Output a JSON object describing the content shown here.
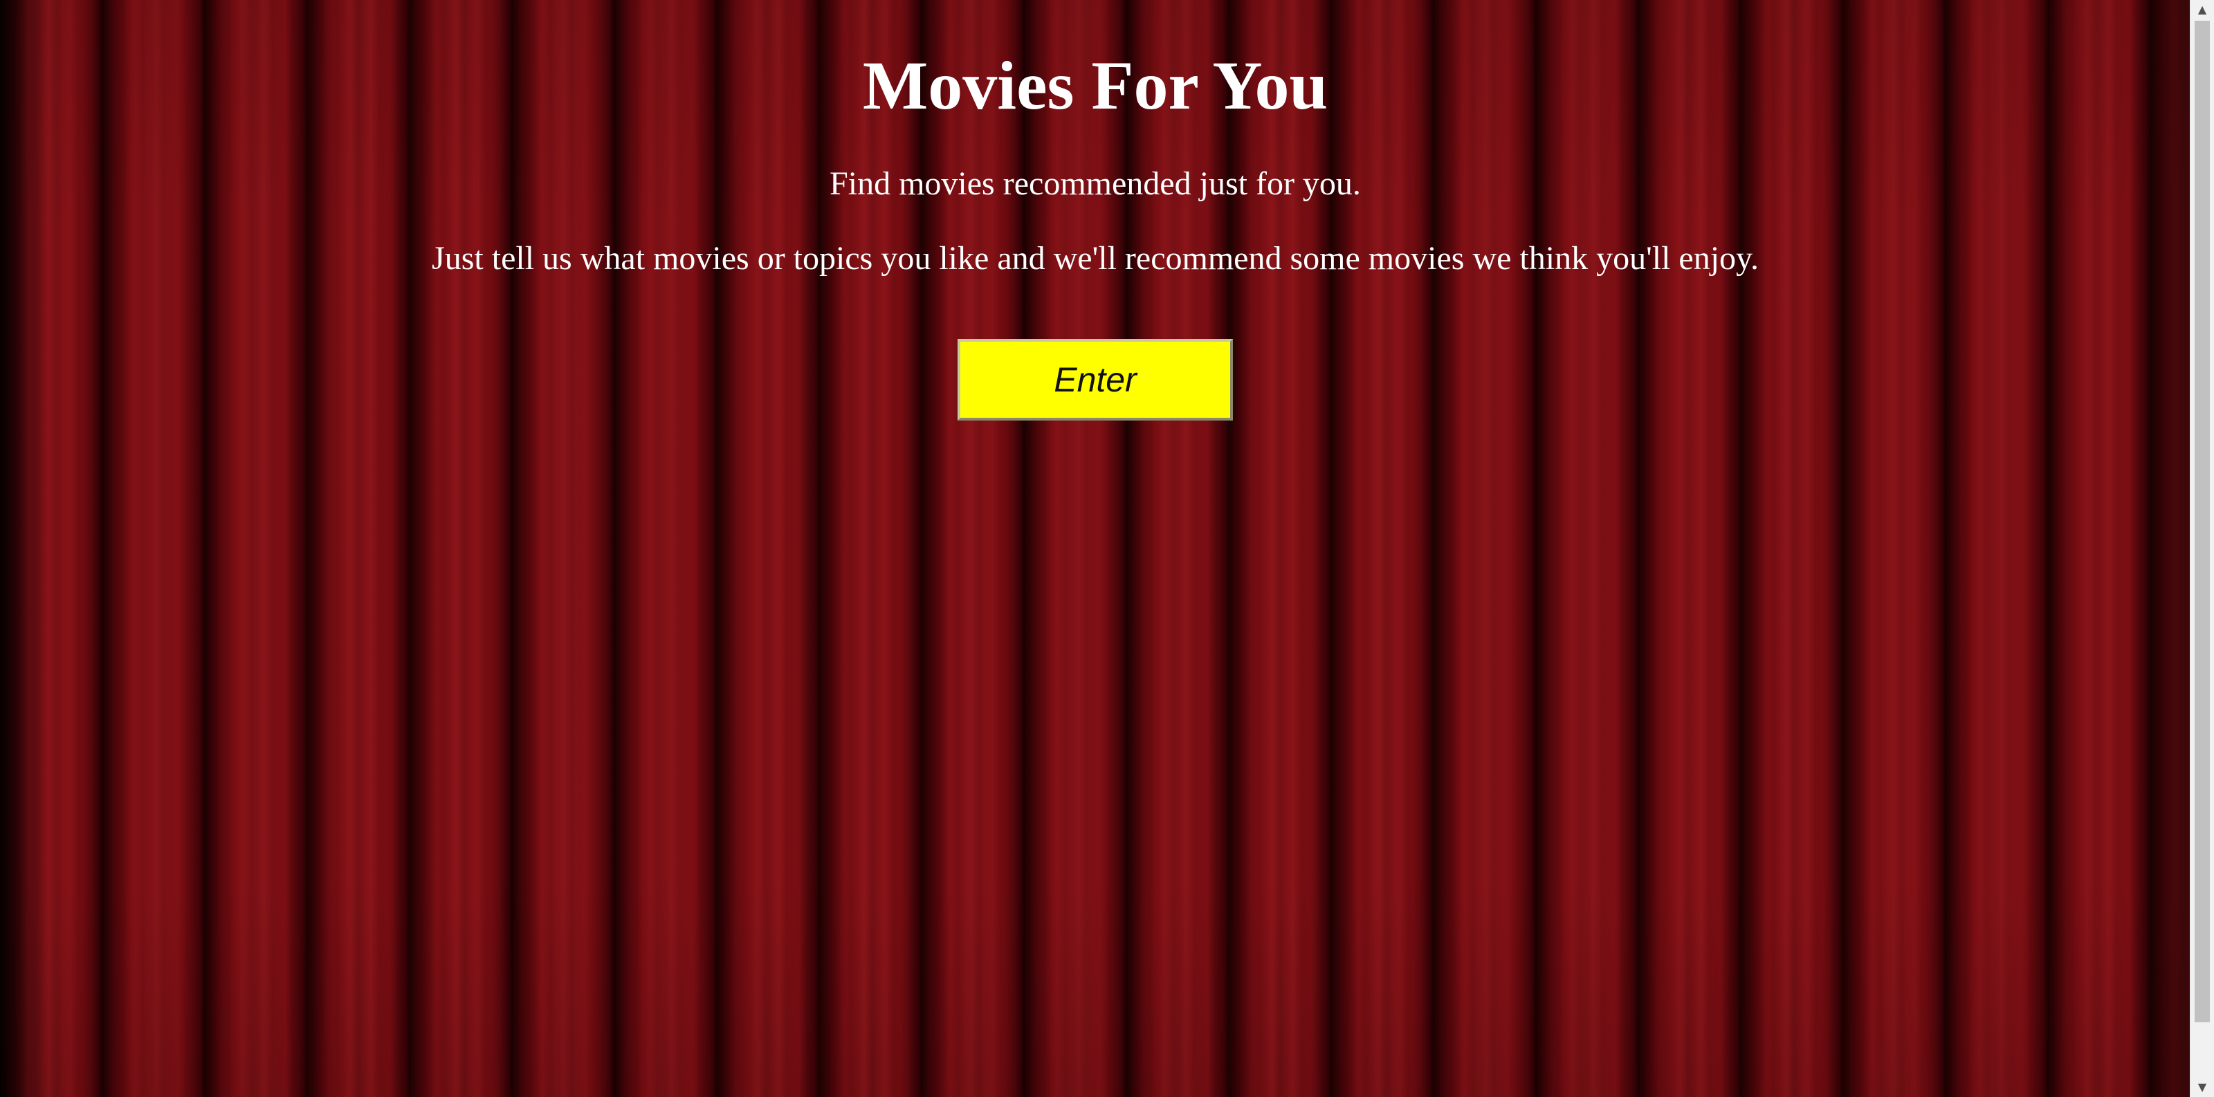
{
  "page": {
    "title": "Movies For You",
    "taglines": [
      "Find movies recommended just for you.",
      "Just tell us what movies or topics you like and we'll recommend some movies we think you'll enjoy."
    ],
    "enter_button_label": "Enter"
  },
  "scrollbar": {
    "up_icon": "scroll-up-arrow-icon",
    "down_icon": "scroll-down-arrow-icon"
  },
  "colors": {
    "curtain": "#7a0f14",
    "text": "#ffffff",
    "button_background": "#ffff00"
  }
}
